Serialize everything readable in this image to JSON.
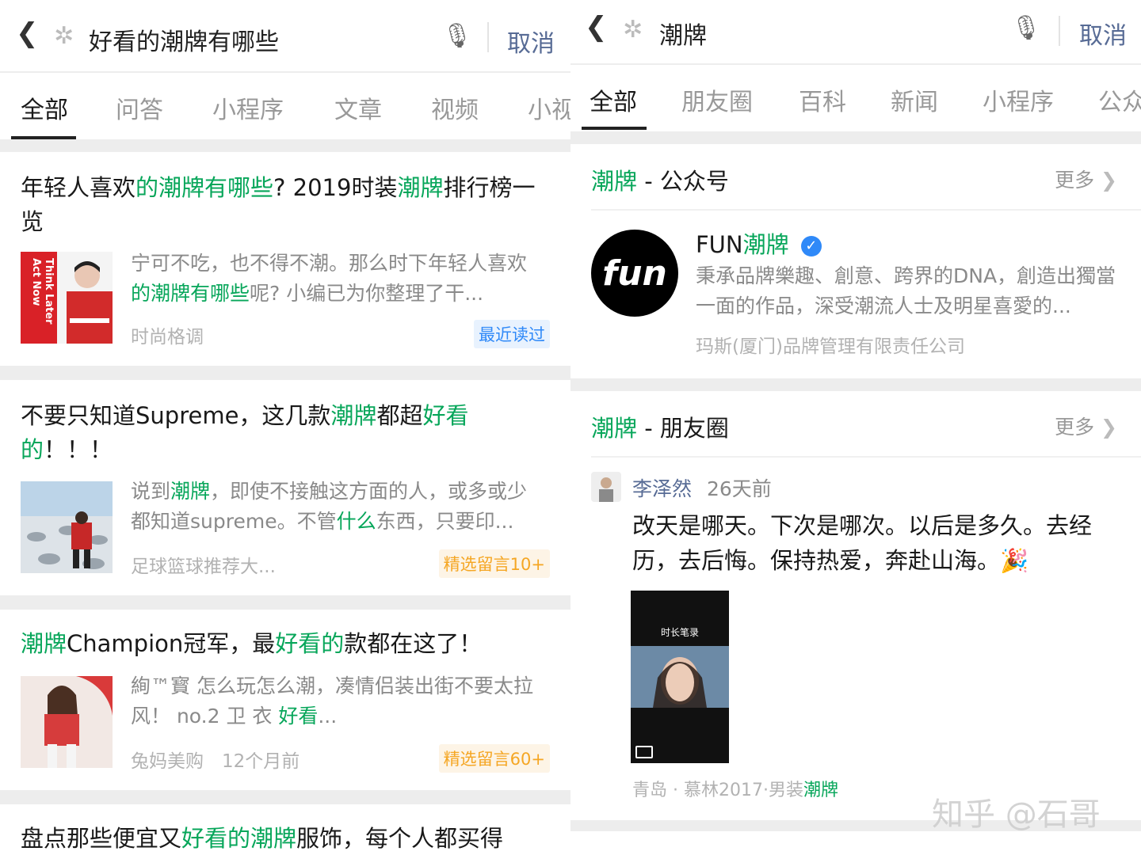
{
  "left": {
    "search": {
      "back_icon": "chevron-left-icon",
      "star_icon": "sparkle-icon",
      "query": "好看的潮牌有哪些",
      "mic_icon": "microphone-icon",
      "cancel": "取消"
    },
    "tabs": [
      "全部",
      "问答",
      "小程序",
      "文章",
      "视频",
      "小视"
    ],
    "results": [
      {
        "title_parts": [
          [
            "年轻人喜欢",
            false
          ],
          [
            "的潮牌有哪些",
            true
          ],
          [
            "? 2019时装",
            false
          ],
          [
            "潮牌",
            true
          ],
          [
            "排行榜一览",
            false
          ]
        ],
        "thumb_text": "Act Now Think Later",
        "snippet_parts": [
          [
            "宁可不吃，也不得不潮。那么时下年轻人喜欢",
            false
          ],
          [
            "的潮牌有哪些",
            true
          ],
          [
            "呢? 小编已为你整理了干...",
            false
          ]
        ],
        "source": "时尚格调",
        "badge": "最近读过"
      },
      {
        "title_parts": [
          [
            "不要只知道Supreme，这几款",
            false
          ],
          [
            "潮牌",
            true
          ],
          [
            "都超",
            false
          ],
          [
            "好看的",
            true
          ],
          [
            "！！！",
            false
          ]
        ],
        "snippet_parts": [
          [
            "说到",
            false
          ],
          [
            "潮牌",
            true
          ],
          [
            "，即使不接触这方面的人，或多或少都知道supreme。不管",
            false
          ],
          [
            "什么",
            true
          ],
          [
            "东西，只要印...",
            false
          ]
        ],
        "source": "足球篮球推荐大...",
        "badge": "精选留言10+"
      },
      {
        "title_parts": [
          [
            "潮牌",
            true
          ],
          [
            "Champion冠军，最",
            false
          ],
          [
            "好看的",
            true
          ],
          [
            "款都在这了！",
            false
          ]
        ],
        "snippet_parts": [
          [
            "絢™寳 怎么玩怎么潮，凑情侣装出街不要太拉风！ no.2 卫 衣 ",
            false
          ],
          [
            "好看",
            true
          ],
          [
            "...",
            false
          ]
        ],
        "source": "兔妈美购",
        "time": "12个月前",
        "badge": "精选留言60+"
      },
      {
        "title_parts": [
          [
            "盘点那些便宜又",
            false
          ],
          [
            "好看的潮牌",
            true
          ],
          [
            "服饰，每个人都买得",
            false
          ]
        ]
      }
    ]
  },
  "right": {
    "search": {
      "back_icon": "chevron-left-icon",
      "star_icon": "sparkle-icon",
      "query": "潮牌",
      "mic_icon": "microphone-icon",
      "cancel": "取消"
    },
    "tabs": [
      "全部",
      "朋友圈",
      "百科",
      "新闻",
      "小程序",
      "公众"
    ],
    "account_section": {
      "head_hl": "潮牌",
      "head_rest": " - 公众号",
      "more": "更多",
      "logo_text": "fun",
      "name_plain": "FUN",
      "name_hl": "潮牌",
      "verified_icon": "verified-badge-icon",
      "desc": "秉承品牌樂趣、創意、跨界的DNA，創造出獨當一面的作品，深受潮流人士及明星喜愛的...",
      "company": "玛斯(厦门)品牌管理有限责任公司"
    },
    "moments_section": {
      "head_hl": "潮牌",
      "head_rest": " - 朋友圈",
      "more": "更多",
      "user": "李泽然",
      "time": "26天前",
      "text": "改天是哪天。下次是哪次。以后是多久。去经历，去后悔。保持热爱，奔赴山海。",
      "emoji_icon": "party-popper-icon",
      "video_caption": "时长笔录",
      "location_plain": "青岛 · 慕林2017·男装",
      "location_hl": "潮牌"
    },
    "watermark": "知乎 @石哥"
  },
  "colors": {
    "highlight": "#07a65a",
    "cancel": "#576b95",
    "badge_blue": "#2f89f8",
    "badge_orange": "#f5a623",
    "background": "#ededed"
  }
}
